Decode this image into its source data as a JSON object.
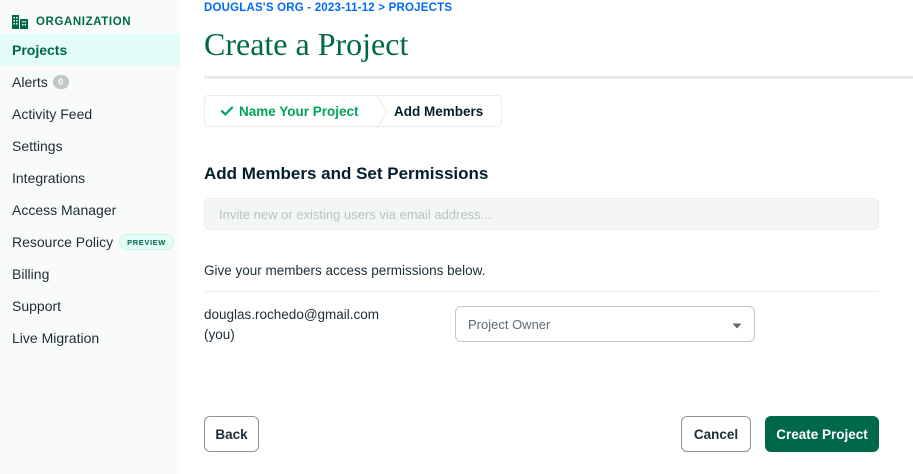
{
  "sidebar": {
    "org_label": "ORGANIZATION",
    "org_icon": "building-icon",
    "items": [
      {
        "label": "Projects",
        "active": true
      },
      {
        "label": "Alerts",
        "badge": "0"
      },
      {
        "label": "Activity Feed"
      },
      {
        "label": "Settings"
      },
      {
        "label": "Integrations"
      },
      {
        "label": "Access Manager"
      },
      {
        "label": "Resource Policy",
        "tag": "PREVIEW"
      },
      {
        "label": "Billing"
      },
      {
        "label": "Support"
      },
      {
        "label": "Live Migration"
      }
    ]
  },
  "header": {
    "breadcrumb": "DOUGLAS'S ORG - 2023-11-12 > PROJECTS",
    "title": "Create a Project"
  },
  "stepper": {
    "steps": [
      {
        "label": "Name Your Project",
        "status": "complete",
        "icon": "check-icon"
      },
      {
        "label": "Add Members",
        "status": "current"
      }
    ]
  },
  "form": {
    "section_title": "Add Members and Set Permissions",
    "invite_placeholder": "Invite new or existing users via email address...",
    "permissions_text": "Give your members access permissions below.",
    "members": [
      {
        "email": "douglas.rochedo@gmail.com (you)",
        "role": "Project Owner"
      }
    ]
  },
  "actions": {
    "back": "Back",
    "cancel": "Cancel",
    "create": "Create Project"
  },
  "colors": {
    "brand_green": "#00684a",
    "step_complete": "#00a35c",
    "breadcrumb_blue": "#016bf8",
    "sidebar_active_bg": "#e3fcf7"
  }
}
